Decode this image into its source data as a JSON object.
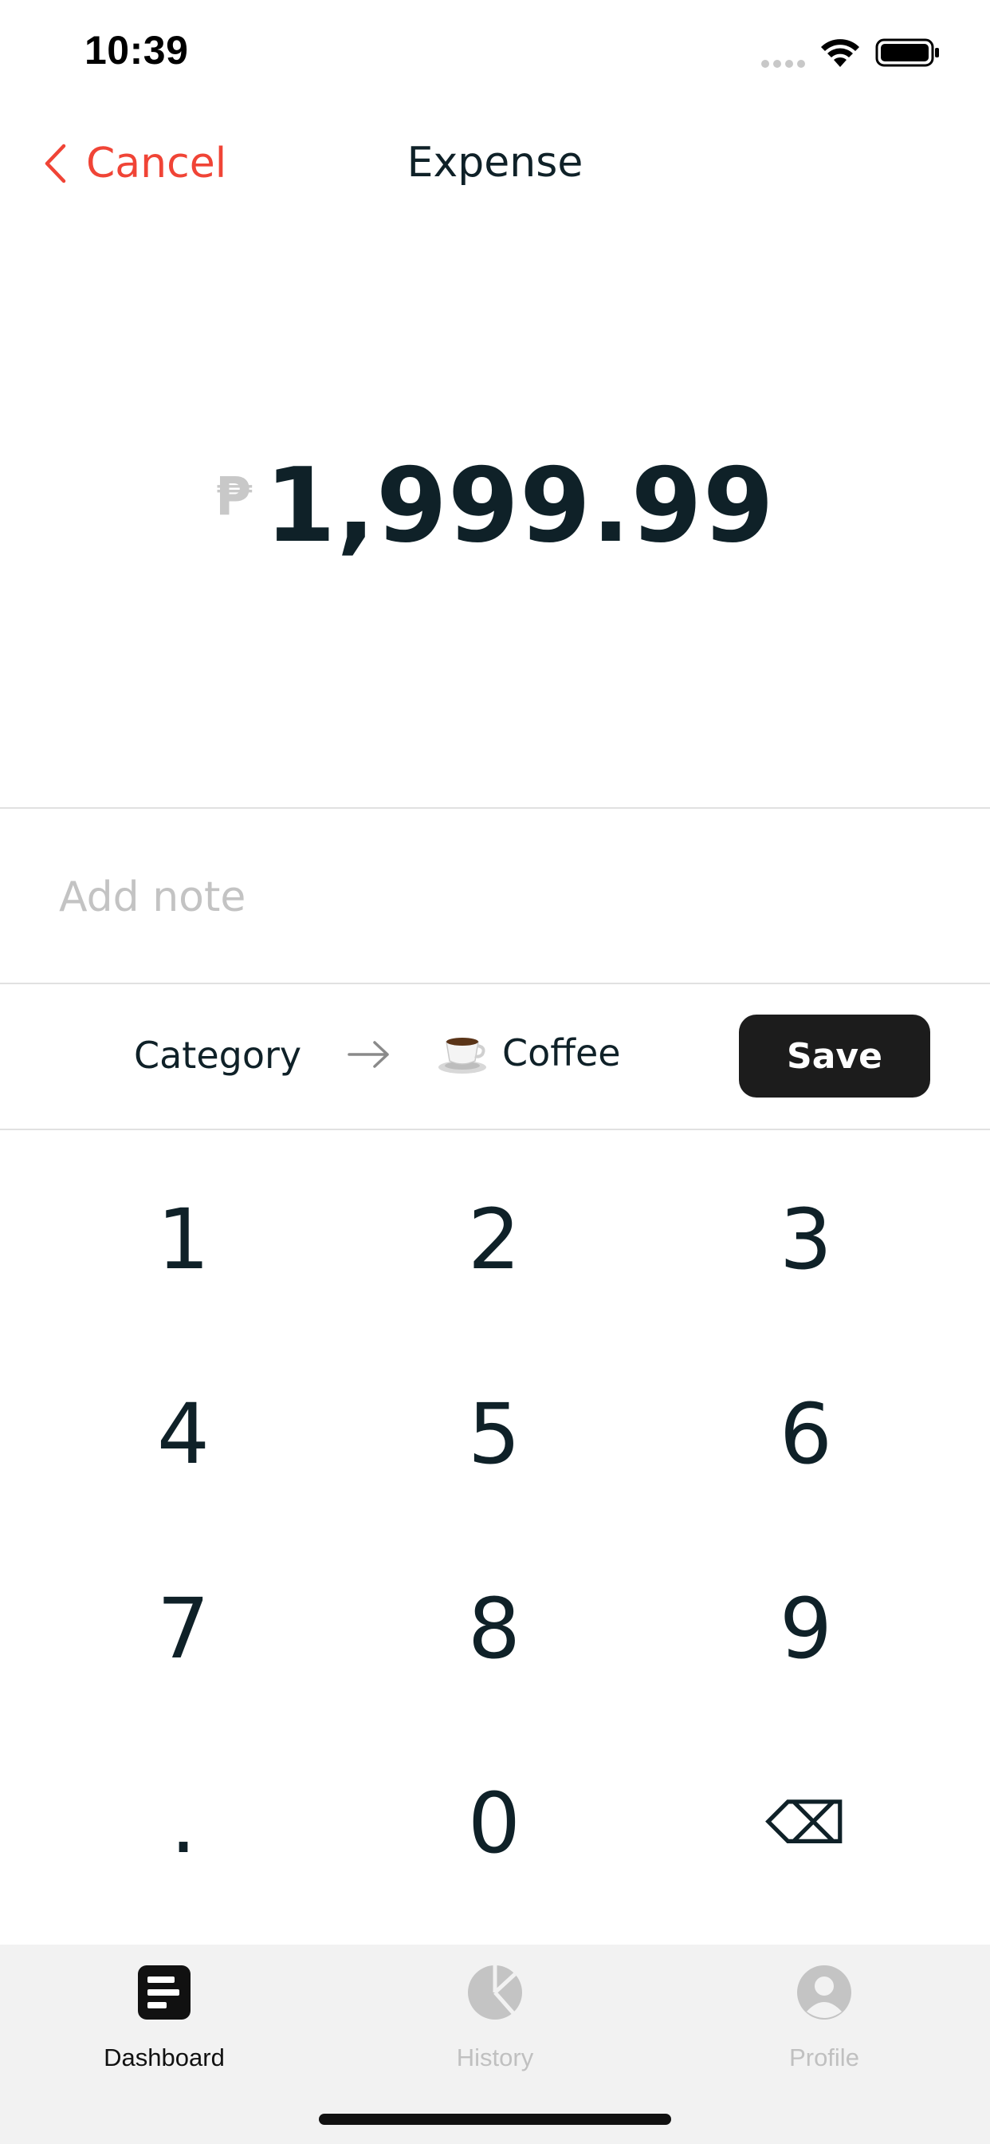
{
  "status_bar": {
    "time": "10:39"
  },
  "nav": {
    "cancel_label": "Cancel",
    "title": "Expense"
  },
  "amount": {
    "currency_symbol": "₱",
    "value": "1,999.99"
  },
  "note": {
    "placeholder": "Add note",
    "value": ""
  },
  "category": {
    "label": "Category",
    "selected": "Coffee",
    "icon": "coffee-cup-icon"
  },
  "save_label": "Save",
  "keypad": {
    "keys": [
      "1",
      "2",
      "3",
      "4",
      "5",
      "6",
      "7",
      "8",
      "9",
      ".",
      "0",
      "⌫"
    ]
  },
  "tab_bar": {
    "tabs": [
      {
        "label": "Dashboard",
        "icon": "dashboard-icon",
        "active": true
      },
      {
        "label": "History",
        "icon": "pie-chart-icon",
        "active": false
      },
      {
        "label": "Profile",
        "icon": "profile-icon",
        "active": false
      }
    ]
  },
  "colors": {
    "accent": "#f04436",
    "text": "#0f2128",
    "save_button": "#1c1c1c",
    "tab_bar_bg": "#f2f2f2",
    "inactive": "#c0c0c0"
  }
}
